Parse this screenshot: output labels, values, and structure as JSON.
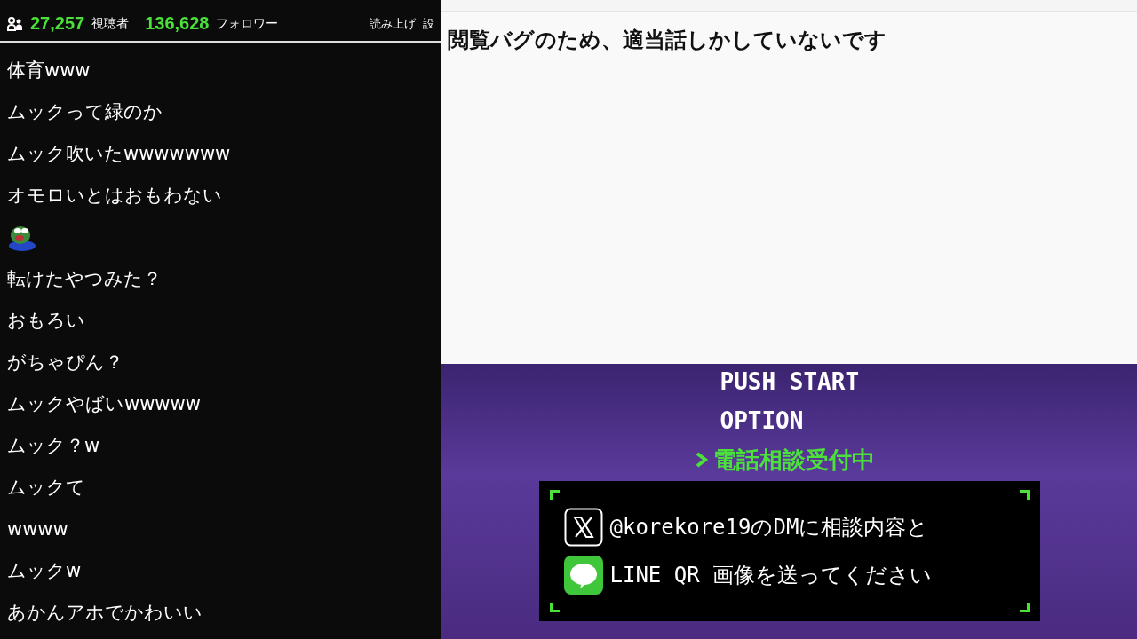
{
  "stats": {
    "viewers": "27,257",
    "viewers_label": "視聴者",
    "followers": "136,628",
    "followers_label": "フォロワー"
  },
  "toolbar": [
    {
      "label": "読み上げ"
    },
    {
      "label": "設"
    }
  ],
  "comments": [
    {
      "kind": "text",
      "text": "体育www"
    },
    {
      "kind": "text",
      "text": "ムックって緑のか"
    },
    {
      "kind": "text",
      "text": "ムック吹いたwwwwwww"
    },
    {
      "kind": "text",
      "text": "オモロいとはおもわない"
    },
    {
      "kind": "emote"
    },
    {
      "kind": "text",
      "text": "転けたやつみた？"
    },
    {
      "kind": "text",
      "text": "おもろい"
    },
    {
      "kind": "text",
      "text": "がちゃぴん？"
    },
    {
      "kind": "text",
      "text": "ムックやばいwwwww"
    },
    {
      "kind": "text",
      "text": "ムック？w"
    },
    {
      "kind": "text",
      "text": "ムックて"
    },
    {
      "kind": "text",
      "text": "wwww"
    },
    {
      "kind": "text",
      "text": "ムックw"
    },
    {
      "kind": "text",
      "text": "あかんアホでかわいい"
    }
  ],
  "note": {
    "text": "閲覧バグのため、適当話しかしていないです"
  },
  "overlay": {
    "menu": [
      {
        "text": "PUSH START",
        "selected": false
      },
      {
        "text": "OPTION",
        "selected": false
      },
      {
        "text": "電話相談受付中",
        "selected": true
      }
    ],
    "contact": [
      {
        "kind": "x",
        "text": "@korekore19のDMに相談内容と"
      },
      {
        "kind": "line",
        "text": "LINE QR 画像を送ってください"
      }
    ]
  }
}
